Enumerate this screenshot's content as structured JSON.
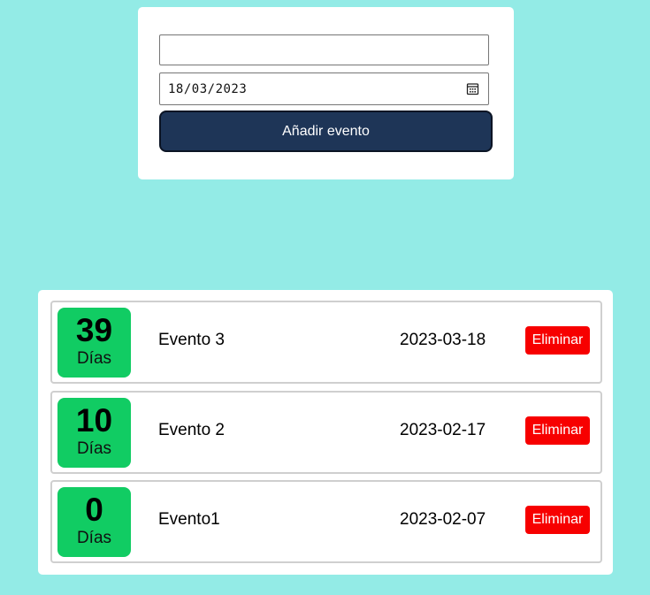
{
  "form": {
    "name_value": "",
    "name_placeholder": "",
    "date_value": "18/03/2023",
    "add_label": "Añadir evento"
  },
  "events": [
    {
      "days": "39",
      "days_label": "Días",
      "name": "Evento 3",
      "date": "2023-03-18",
      "delete_label": "Eliminar"
    },
    {
      "days": "10",
      "days_label": "Días",
      "name": "Evento 2",
      "date": "2023-02-17",
      "delete_label": "Eliminar"
    },
    {
      "days": "0",
      "days_label": "Días",
      "name": "Evento1",
      "date": "2023-02-07",
      "delete_label": "Eliminar"
    }
  ],
  "colors": {
    "background": "#93ebe6",
    "button": "#1e3557",
    "days_badge": "#11cc63",
    "delete": "#f70000"
  },
  "icons": {
    "date_picker": "calendar-icon"
  }
}
